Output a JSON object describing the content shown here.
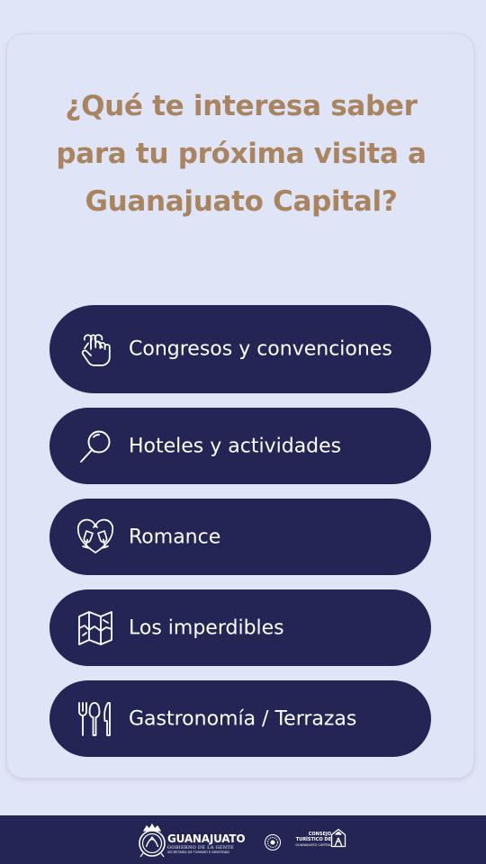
{
  "question": "¿Qué te interesa saber para tu próxima visita a Guanajuato Capital?",
  "options": [
    {
      "label": "Congresos y convenciones",
      "icon": "hand-ribbon-icon"
    },
    {
      "label": "Hoteles y actividades",
      "icon": "magnifier-icon"
    },
    {
      "label": "Romance",
      "icon": "heart-toast-icon"
    },
    {
      "label": "Los imperdibles",
      "icon": "map-icon"
    },
    {
      "label": "Gastronomía / Terrazas",
      "icon": "cutlery-icon"
    }
  ],
  "footer": {
    "logo_title": "GUANAJUATO",
    "logo_subtitle": "GOBIERNO DE LA GENTE",
    "logo_department": "SECRETARÍA DE TURISMO E IDENTIDAD",
    "consejo_line1": "CONSEJO",
    "consejo_line2": "TURÍSTICO DE",
    "consejo_line3": "GUANAJUATO CAPITAL"
  },
  "colors": {
    "background": "#e1e5f8",
    "heading": "#a88460",
    "button": "#232654",
    "button_text": "#ffffff"
  }
}
